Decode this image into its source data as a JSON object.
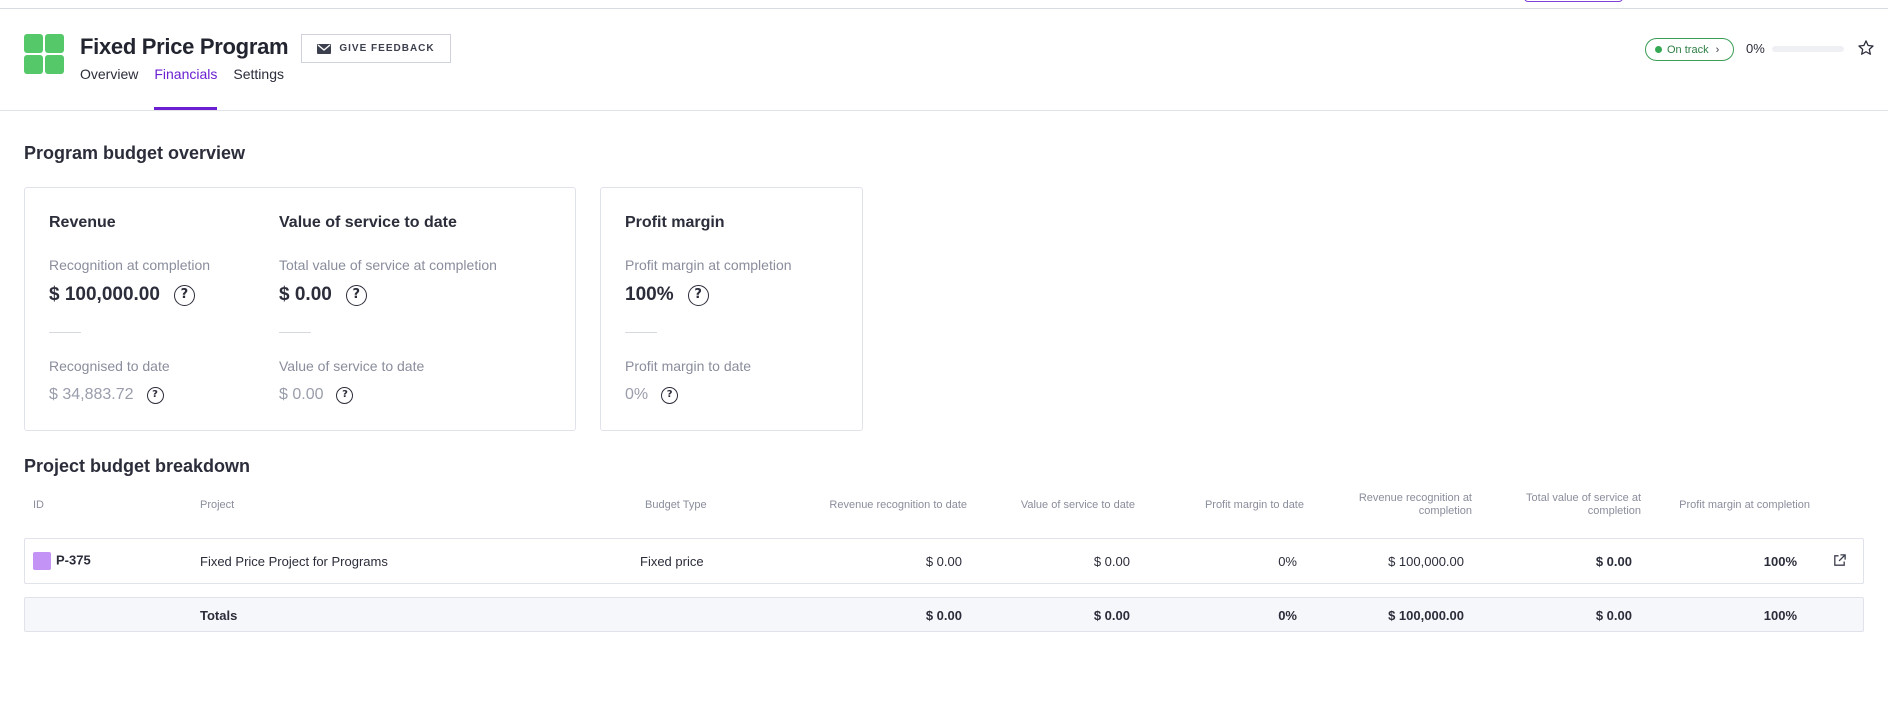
{
  "header": {
    "title": "Fixed Price Program",
    "feedback_label": "GIVE FEEDBACK",
    "tabs": [
      {
        "label": "Overview"
      },
      {
        "label": "Financials",
        "active": true
      },
      {
        "label": "Settings"
      }
    ],
    "status": "On track",
    "progress_text": "0%",
    "progress_value": 0
  },
  "budget": {
    "title": "Program budget overview",
    "revenue": {
      "title": "Revenue",
      "completion_label": "Recognition at completion",
      "completion_value": "$ 100,000.00",
      "to_date_label": "Recognised to date",
      "to_date_value": "$ 34,883.72"
    },
    "service": {
      "title": "Value of service to date",
      "completion_label": "Total value of service at completion",
      "completion_value": "$ 0.00",
      "to_date_label": "Value of service to date",
      "to_date_value": "$ 0.00"
    },
    "profit": {
      "title": "Profit margin",
      "completion_label": "Profit margin at completion",
      "completion_value": "100%",
      "to_date_label": "Profit margin to date",
      "to_date_value": "0%"
    },
    "help_glyph": "?"
  },
  "breakdown": {
    "title": "Project budget breakdown",
    "columns": {
      "id": "ID",
      "project": "Project",
      "budget_type": "Budget Type",
      "rev_to_date": "Revenue recognition to date",
      "service_to_date": "Value of service to date",
      "margin_to_date": "Profit margin to date",
      "rev_completion": "Revenue recognition at completion",
      "service_completion": "Total value of service at completion",
      "margin_completion": "Profit margin at completion"
    },
    "row": {
      "id": "P-375",
      "color": "#c393f5",
      "project": "Fixed Price Project for Programs",
      "budget_type": "Fixed price",
      "rev_to_date": "$ 0.00",
      "service_to_date": "$ 0.00",
      "margin_to_date": "0%",
      "rev_completion": "$ 100,000.00",
      "service_completion": "$ 0.00",
      "margin_completion": "100%"
    },
    "totals": {
      "label": "Totals",
      "rev_to_date": "$ 0.00",
      "service_to_date": "$ 0.00",
      "margin_to_date": "0%",
      "rev_completion": "$ 100,000.00",
      "service_completion": "$ 0.00",
      "margin_completion": "100%"
    }
  },
  "colors": {
    "accent": "#6b1fd1",
    "logo": "#55c96a",
    "status_green": "#34a853"
  },
  "icons": [
    "app-logo-icon",
    "mail-icon",
    "chevron-right-icon",
    "star-icon",
    "help-icon",
    "external-link-icon"
  ]
}
